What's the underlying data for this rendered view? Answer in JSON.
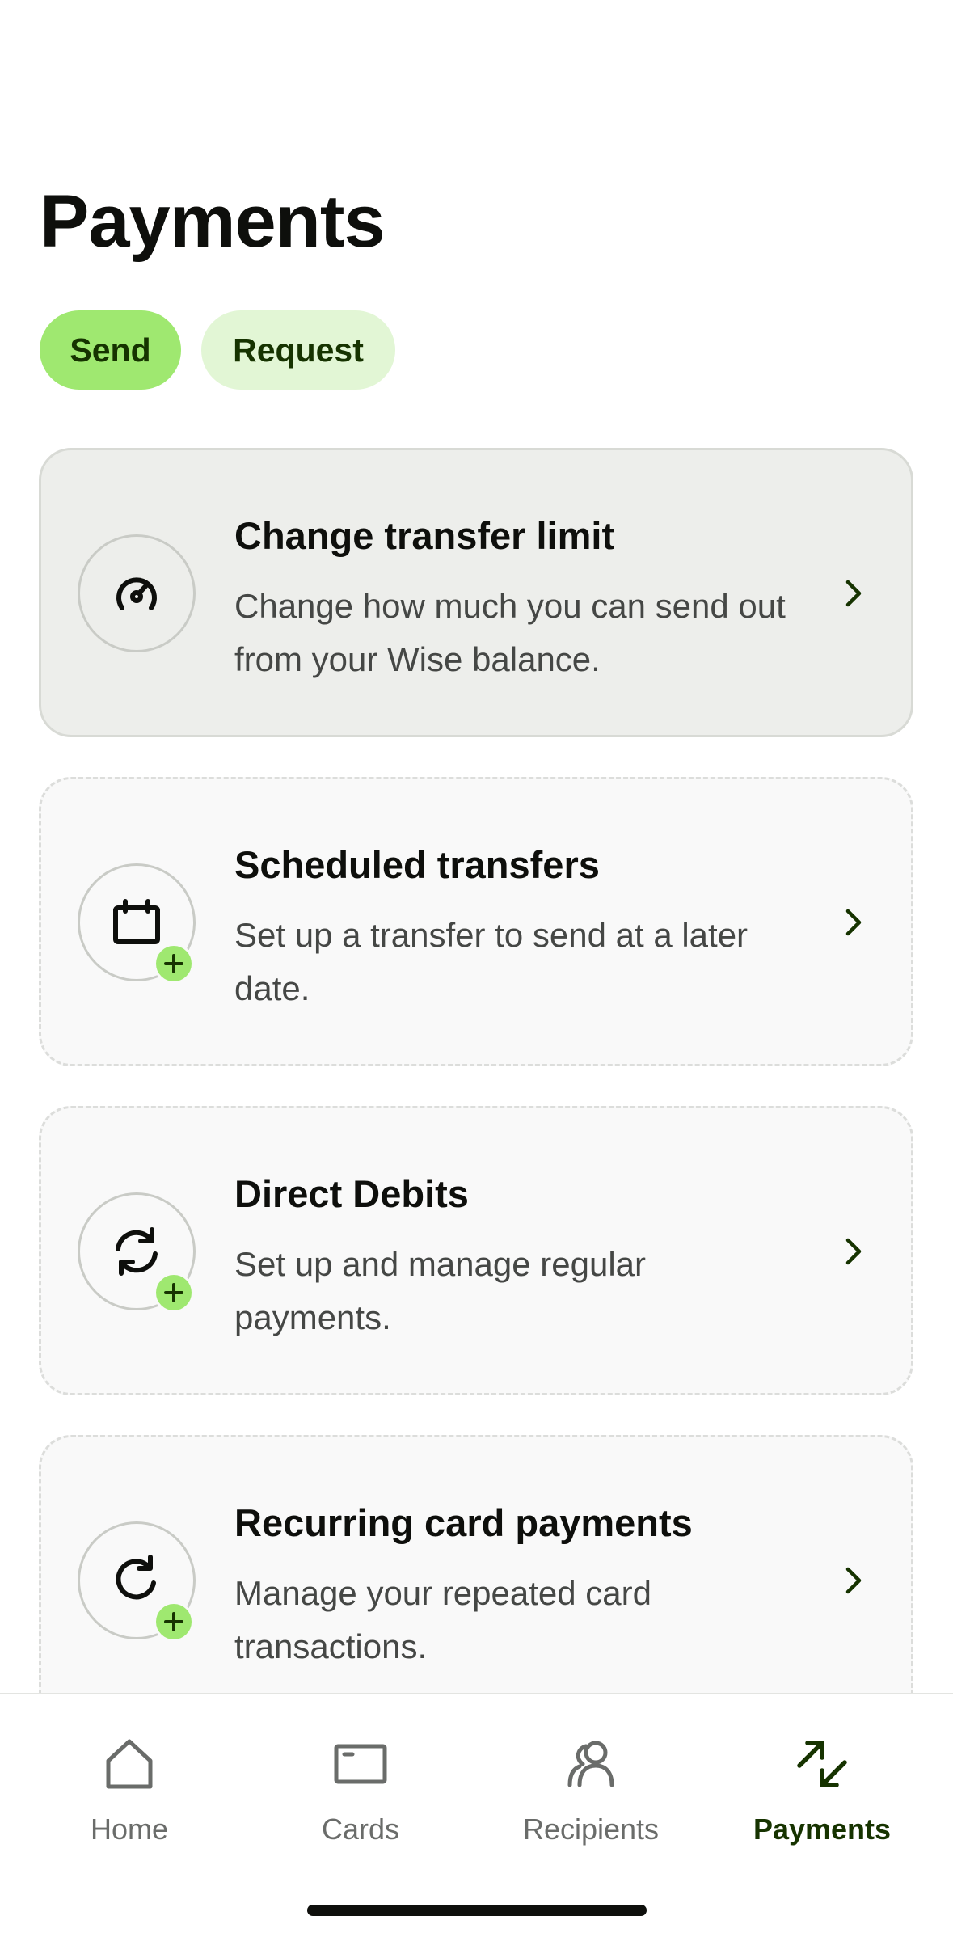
{
  "header": {
    "title": "Payments"
  },
  "segments": {
    "send_label": "Send",
    "request_label": "Request",
    "selected": "Send"
  },
  "cards": [
    {
      "title": "Change transfer limit",
      "description": "Change how much you can send out from your Wise balance.",
      "icon": "speedometer-icon"
    },
    {
      "title": "Scheduled transfers",
      "description": "Set up a transfer to send at a later date.",
      "icon": "calendar-icon"
    },
    {
      "title": "Direct Debits",
      "description": "Set up and manage regular payments.",
      "icon": "sync-arrows-icon"
    },
    {
      "title": "Recurring card payments",
      "description": "Manage your repeated card transactions.",
      "icon": "refresh-icon"
    }
  ],
  "tabbar": {
    "items": [
      {
        "label": "Home",
        "icon": "home-icon"
      },
      {
        "label": "Cards",
        "icon": "card-icon"
      },
      {
        "label": "Recipients",
        "icon": "recipients-icon"
      },
      {
        "label": "Payments",
        "icon": "payments-arrows-icon"
      }
    ],
    "active": "Payments"
  },
  "colors": {
    "accent_green": "#9fe870",
    "accent_green_light": "#e2f6d5",
    "dark_green": "#163300",
    "text_primary": "#0e0f0c",
    "text_secondary": "#454745"
  }
}
